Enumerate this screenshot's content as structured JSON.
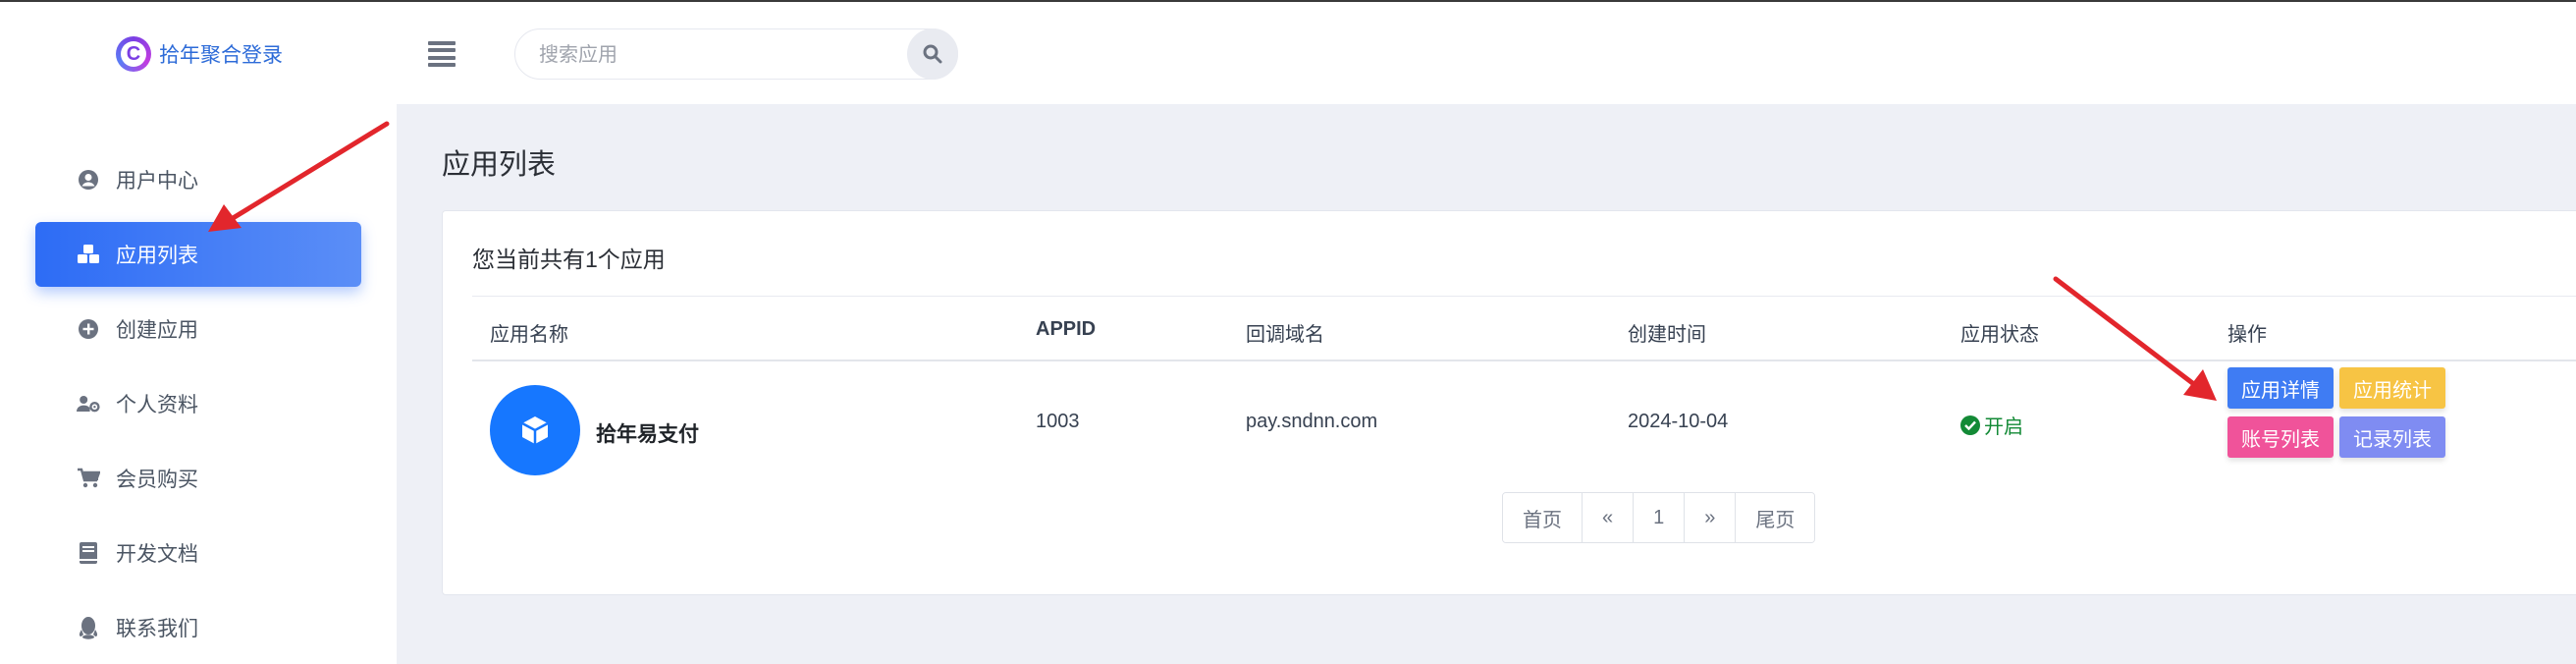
{
  "header": {
    "logo_letter": "C",
    "logo_text": "拾年聚合登录",
    "search": {
      "placeholder": "搜索应用",
      "value": ""
    }
  },
  "sidebar": {
    "items": [
      {
        "label": "用户中心",
        "icon": "user-circle-icon",
        "active": false
      },
      {
        "label": "应用列表",
        "icon": "cubes-icon",
        "active": true
      },
      {
        "label": "创建应用",
        "icon": "plus-circle-icon",
        "active": false
      },
      {
        "label": "个人资料",
        "icon": "user-cog-icon",
        "active": false
      },
      {
        "label": "会员购买",
        "icon": "cart-icon",
        "active": false
      },
      {
        "label": "开发文档",
        "icon": "book-icon",
        "active": false
      },
      {
        "label": "联系我们",
        "icon": "qq-icon",
        "active": false
      }
    ]
  },
  "main": {
    "page_title": "应用列表",
    "summary": "您当前共有1个应用",
    "table": {
      "columns": [
        "应用名称",
        "APPID",
        "回调域名",
        "创建时间",
        "应用状态",
        "操作"
      ],
      "rows": [
        {
          "name": "拾年易支付",
          "appid": "1003",
          "domain": "pay.sndnn.com",
          "created": "2024-10-04",
          "status": "开启",
          "actions": [
            "应用详情",
            "应用统计",
            "账号列表",
            "记录列表"
          ]
        }
      ]
    },
    "pagination": {
      "first": "首页",
      "prev": "«",
      "current": "1",
      "next": "»",
      "last": "尾页"
    }
  },
  "colors": {
    "primary": "#2d6cf5",
    "details_btn": "#3f7cf3",
    "stats_btn": "#f7c444",
    "accounts_btn": "#f0539a",
    "records_btn": "#7f8cf2",
    "status_on": "#138a36",
    "annotation_arrow": "#e2262c"
  }
}
